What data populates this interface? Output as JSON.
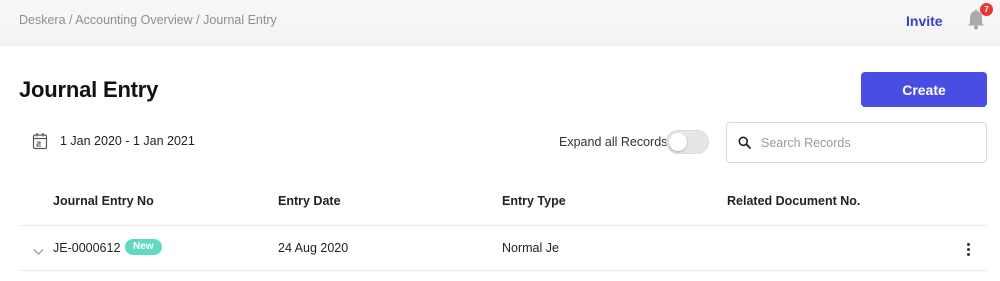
{
  "topbar": {
    "breadcrumb": [
      "Deskera",
      "Accounting Overview",
      "Journal Entry"
    ],
    "breadcrumb_separator": " / ",
    "invite_label": "Invite",
    "notification_count": "7"
  },
  "header": {
    "title": "Journal Entry",
    "create_label": "Create"
  },
  "filters": {
    "date_range": "1 Jan 2020 - 1 Jan 2021",
    "expand_label": "Expand all Records",
    "expand_on": false,
    "search_placeholder": "Search Records",
    "search_value": ""
  },
  "table": {
    "columns": [
      "Journal Entry No",
      "Entry Date",
      "Entry Type",
      "Related Document No."
    ],
    "rows": [
      {
        "entry_no": "JE-0000612",
        "badge": "New",
        "entry_date": "24 Aug 2020",
        "entry_type": "Normal Je",
        "related_doc": ""
      }
    ]
  },
  "colors": {
    "accent": "#4a4de3",
    "invite": "#3a3fbf",
    "badge_new": "#5fd9c4",
    "notification": "#e53935"
  },
  "icons": {
    "calendar": "calendar-icon",
    "bell": "bell-icon",
    "search": "search-icon",
    "chevron": "chevron-down-icon",
    "kebab": "more-vertical-icon"
  }
}
